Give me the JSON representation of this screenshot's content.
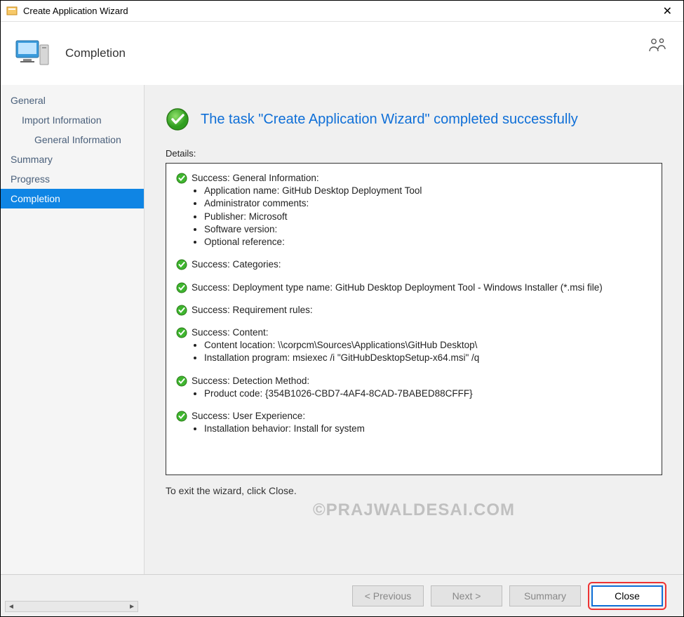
{
  "window": {
    "title": "Create Application Wizard"
  },
  "header": {
    "page_title": "Completion"
  },
  "sidebar": {
    "items": [
      {
        "label": "General"
      },
      {
        "label": "Import Information"
      },
      {
        "label": "General Information"
      },
      {
        "label": "Summary"
      },
      {
        "label": "Progress"
      },
      {
        "label": "Completion"
      }
    ]
  },
  "main": {
    "success_heading": "The task \"Create Application Wizard\" completed successfully",
    "details_label": "Details:",
    "sections": {
      "s0_title": "Success: General Information:",
      "s0_b0": "Application name: GitHub Desktop Deployment Tool",
      "s0_b1": "Administrator comments:",
      "s0_b2": "Publisher: Microsoft",
      "s0_b3": "Software version:",
      "s0_b4": "Optional reference:",
      "s1_title": "Success: Categories:",
      "s2_title": "Success: Deployment type name: GitHub Desktop Deployment Tool - Windows Installer (*.msi file)",
      "s3_title": "Success: Requirement rules:",
      "s4_title": "Success: Content:",
      "s4_b0": "Content location: \\\\corpcm\\Sources\\Applications\\GitHub Desktop\\",
      "s4_b1": "Installation program: msiexec /i \"GitHubDesktopSetup-x64.msi\" /q",
      "s5_title": "Success: Detection Method:",
      "s5_b0": "Product code: {354B1026-CBD7-4AF4-8CAD-7BABED88CFFF}",
      "s6_title": "Success: User Experience:",
      "s6_b0": "Installation behavior: Install for system"
    },
    "exit_text": "To exit the wizard, click Close.",
    "watermark": "©PRAJWALDESAI.COM"
  },
  "footer": {
    "previous": "< Previous",
    "next": "Next >",
    "summary": "Summary",
    "close": "Close"
  }
}
